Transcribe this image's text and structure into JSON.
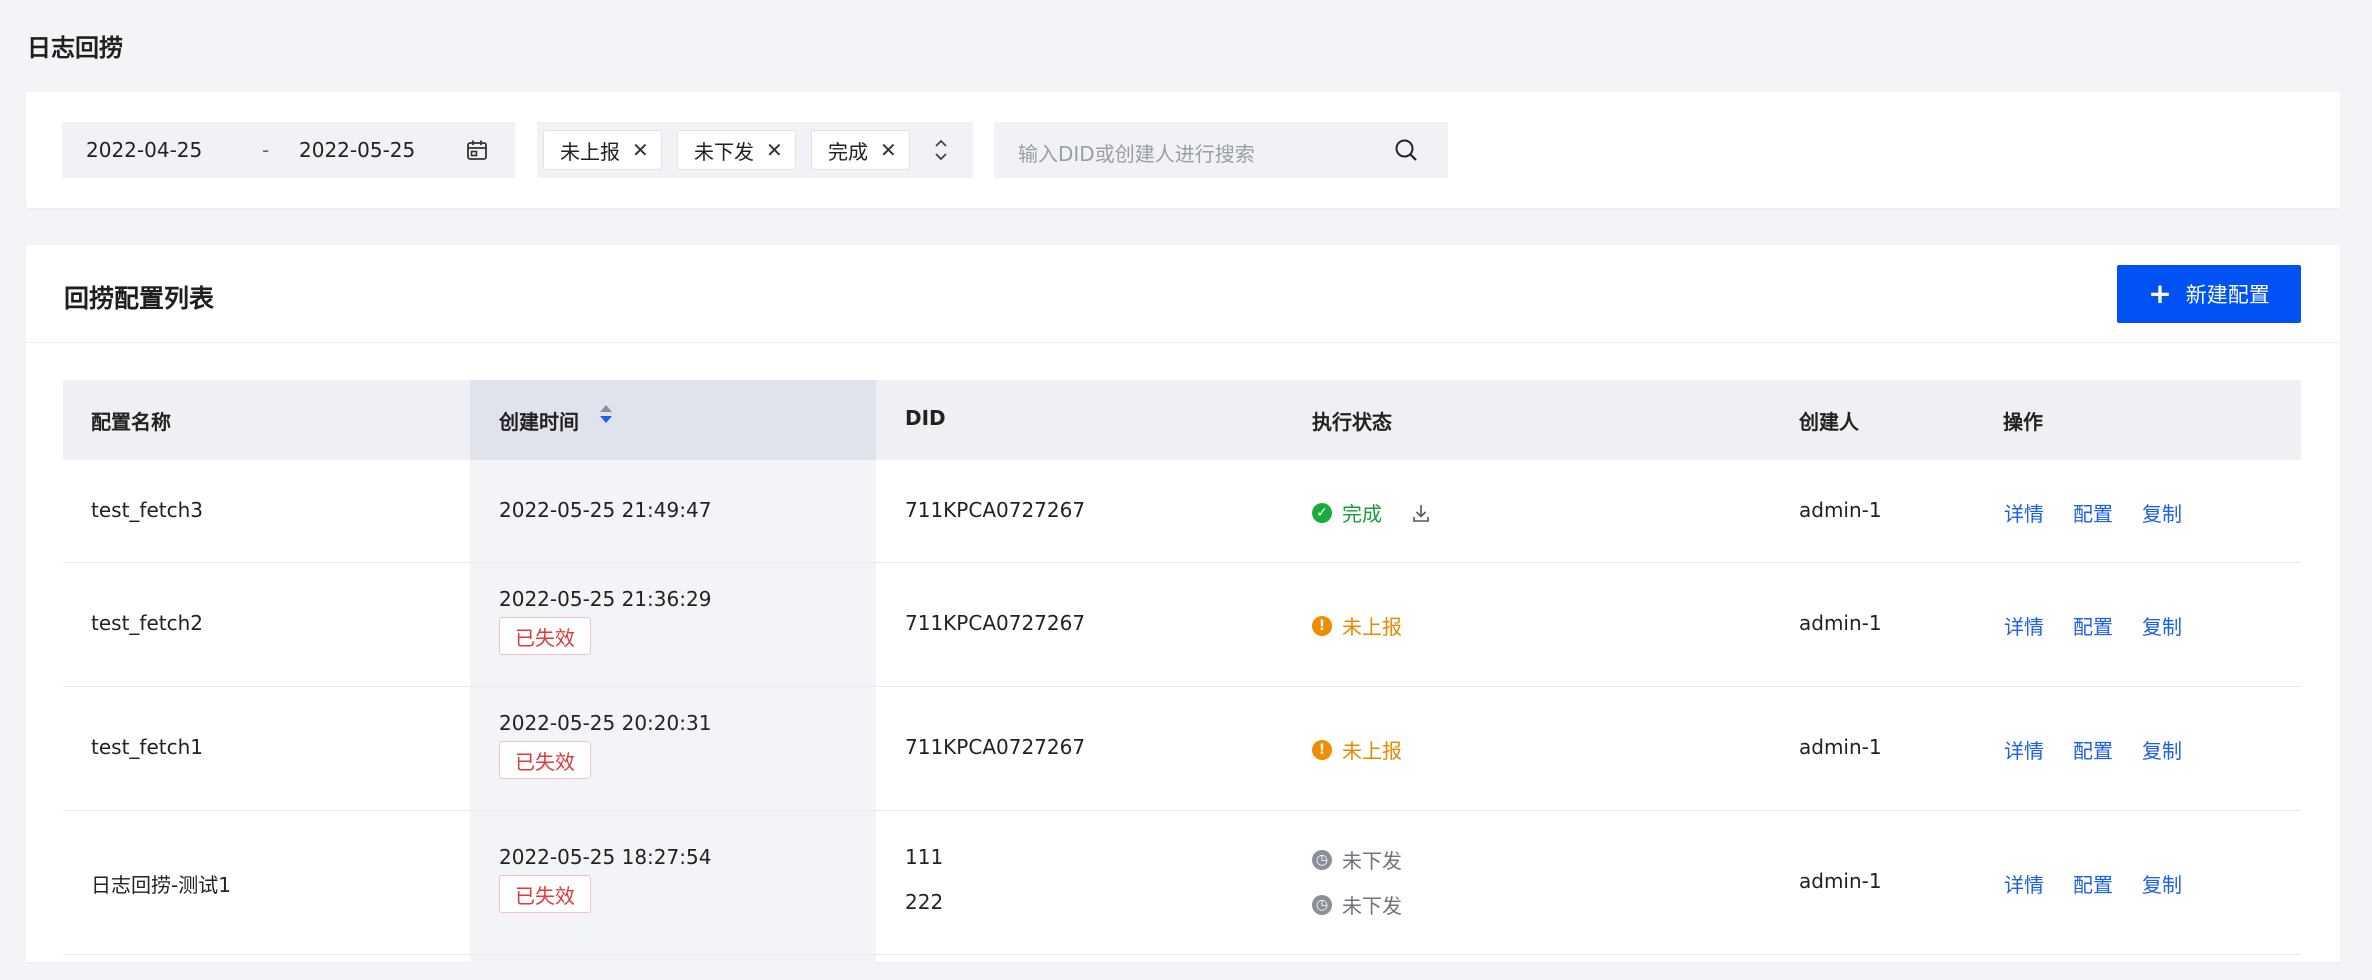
{
  "page": {
    "title": "日志回捞"
  },
  "filters": {
    "date_start": "2022-04-25",
    "date_sep": "-",
    "date_end": "2022-05-25",
    "status_tags": [
      "未上报",
      "未下发",
      "完成"
    ],
    "search_placeholder": "输入DID或创建人进行搜索"
  },
  "list": {
    "title": "回捞配置列表",
    "new_button": "新建配置",
    "columns": [
      "配置名称",
      "创建时间",
      "DID",
      "执行状态",
      "创建人",
      "操作"
    ],
    "actions": [
      "详情",
      "配置",
      "复制"
    ],
    "rows": [
      {
        "name": "test_fetch3",
        "created": "2022-05-25 21:49:47",
        "expired": "",
        "did": [
          "711KPCA0727267"
        ],
        "status": [
          "完成"
        ],
        "creator": "admin-1"
      },
      {
        "name": "test_fetch2",
        "created": "2022-05-25 21:36:29",
        "expired": "已失效",
        "did": [
          "711KPCA0727267"
        ],
        "status": [
          "未上报"
        ],
        "creator": "admin-1"
      },
      {
        "name": "test_fetch1",
        "created": "2022-05-25 20:20:31",
        "expired": "已失效",
        "did": [
          "711KPCA0727267"
        ],
        "status": [
          "未上报"
        ],
        "creator": "admin-1"
      },
      {
        "name": "日志回捞-测试1",
        "created": "2022-05-25 18:27:54",
        "expired": "已失效",
        "did": [
          "111",
          "222"
        ],
        "status": [
          "未下发",
          "未下发"
        ],
        "creator": "admin-1"
      }
    ]
  },
  "colors": {
    "primary": "#0052f5",
    "done": "#1aab3c",
    "warn": "#f08c00",
    "idle": "#8a8f99",
    "expired": "#e03a3a",
    "link": "#1c5ef0"
  }
}
